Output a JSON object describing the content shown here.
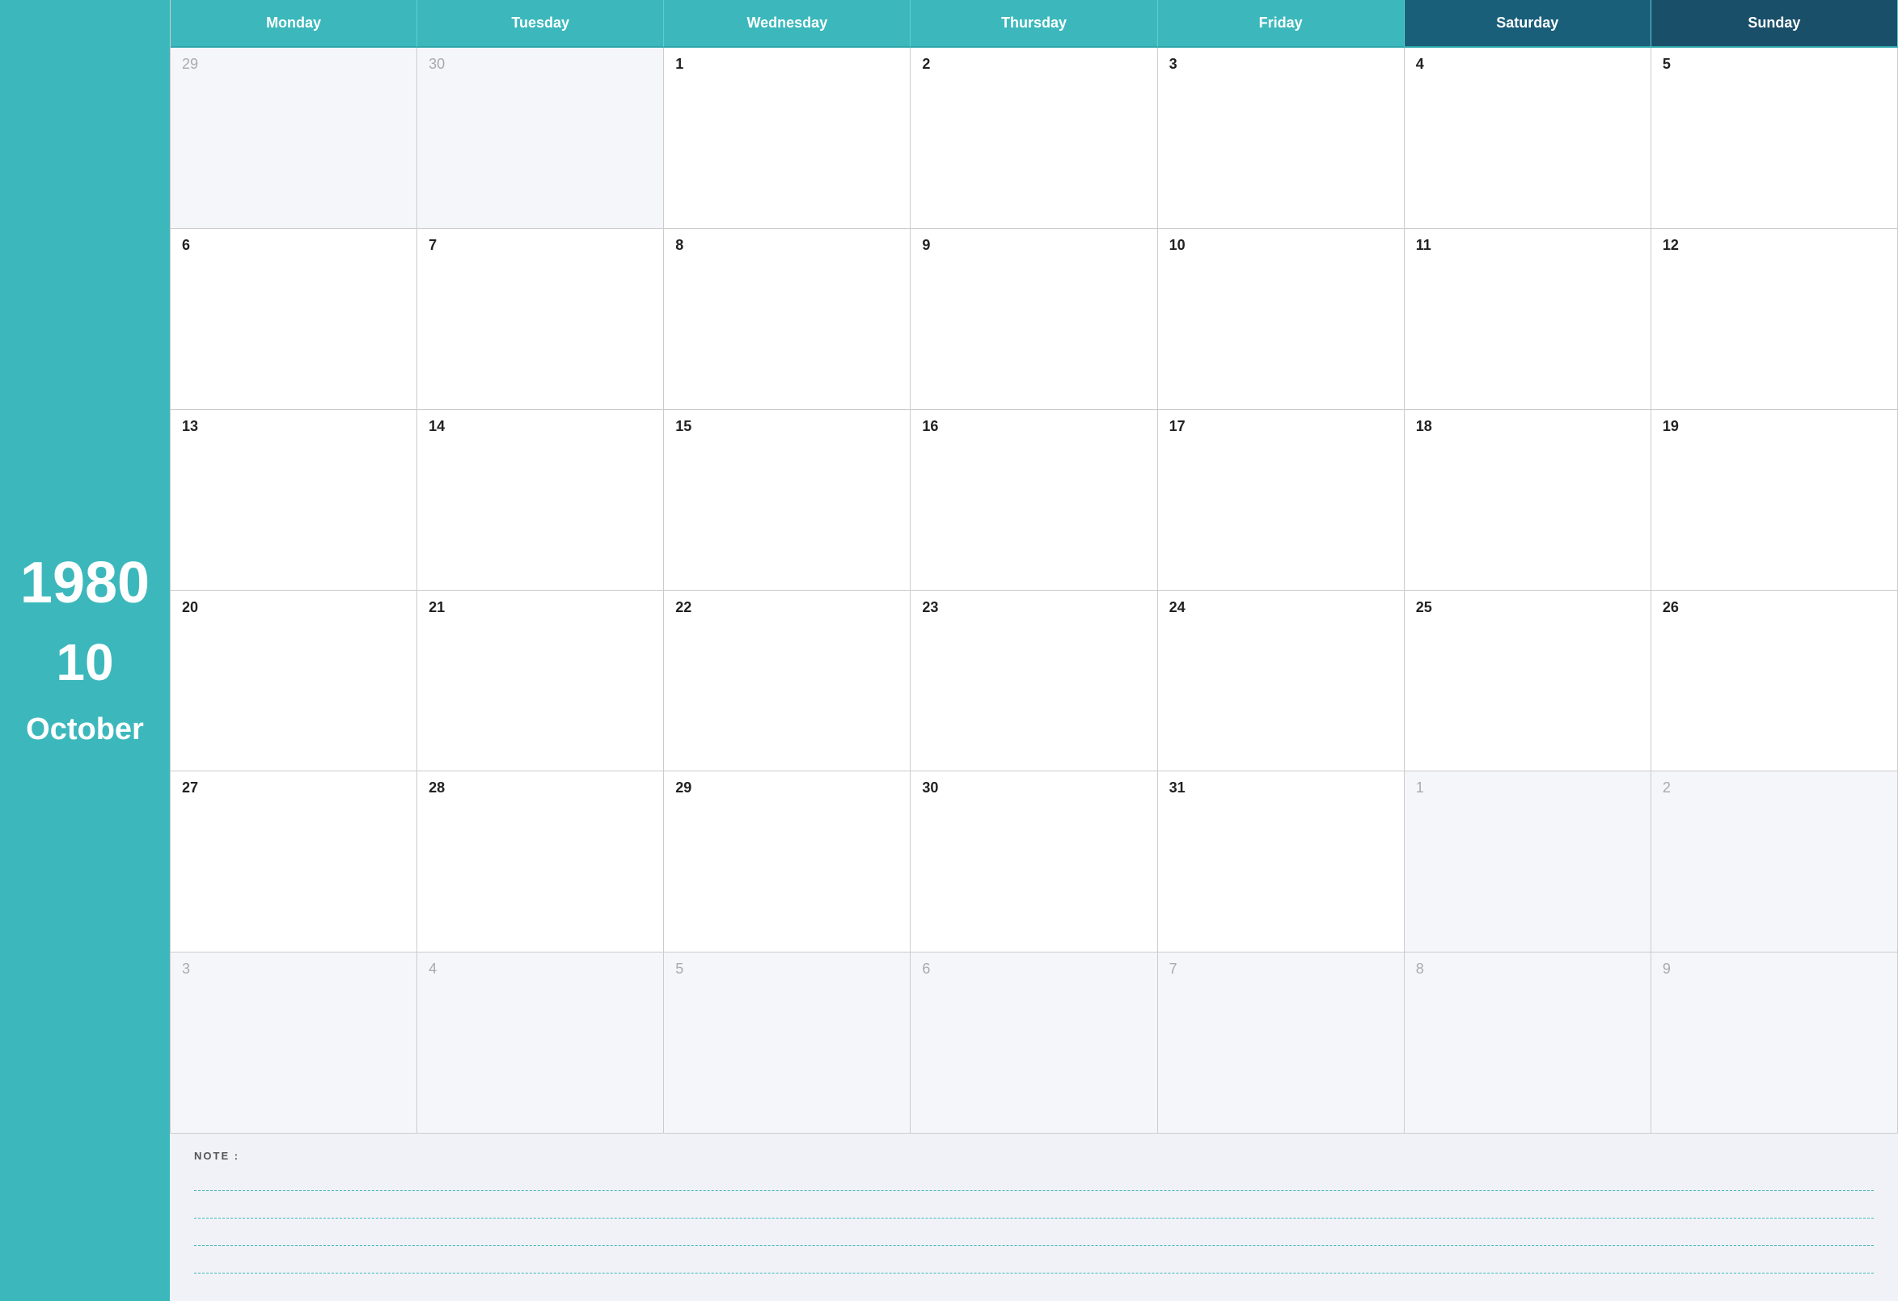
{
  "sidebar": {
    "year": "1980",
    "month_number": "10",
    "month_name": "October"
  },
  "header": {
    "days": [
      {
        "label": "Monday",
        "key": "monday",
        "style": "normal"
      },
      {
        "label": "Tuesday",
        "key": "tuesday",
        "style": "normal"
      },
      {
        "label": "Wednesday",
        "key": "wednesday",
        "style": "normal"
      },
      {
        "label": "Thursday",
        "key": "thursday",
        "style": "normal"
      },
      {
        "label": "Friday",
        "key": "friday",
        "style": "normal"
      },
      {
        "label": "Saturday",
        "key": "saturday",
        "style": "saturday"
      },
      {
        "label": "Sunday",
        "key": "sunday",
        "style": "sunday"
      }
    ]
  },
  "weeks": [
    [
      {
        "num": "29",
        "outside": true
      },
      {
        "num": "30",
        "outside": true
      },
      {
        "num": "1",
        "outside": false
      },
      {
        "num": "2",
        "outside": false
      },
      {
        "num": "3",
        "outside": false
      },
      {
        "num": "4",
        "outside": false
      },
      {
        "num": "5",
        "outside": false
      }
    ],
    [
      {
        "num": "6",
        "outside": false
      },
      {
        "num": "7",
        "outside": false
      },
      {
        "num": "8",
        "outside": false
      },
      {
        "num": "9",
        "outside": false
      },
      {
        "num": "10",
        "outside": false
      },
      {
        "num": "11",
        "outside": false
      },
      {
        "num": "12",
        "outside": false
      }
    ],
    [
      {
        "num": "13",
        "outside": false
      },
      {
        "num": "14",
        "outside": false
      },
      {
        "num": "15",
        "outside": false
      },
      {
        "num": "16",
        "outside": false
      },
      {
        "num": "17",
        "outside": false
      },
      {
        "num": "18",
        "outside": false
      },
      {
        "num": "19",
        "outside": false
      }
    ],
    [
      {
        "num": "20",
        "outside": false
      },
      {
        "num": "21",
        "outside": false
      },
      {
        "num": "22",
        "outside": false
      },
      {
        "num": "23",
        "outside": false
      },
      {
        "num": "24",
        "outside": false
      },
      {
        "num": "25",
        "outside": false
      },
      {
        "num": "26",
        "outside": false
      }
    ],
    [
      {
        "num": "27",
        "outside": false
      },
      {
        "num": "28",
        "outside": false
      },
      {
        "num": "29",
        "outside": false
      },
      {
        "num": "30",
        "outside": false
      },
      {
        "num": "31",
        "outside": false
      },
      {
        "num": "1",
        "outside": true
      },
      {
        "num": "2",
        "outside": true
      }
    ],
    [
      {
        "num": "3",
        "outside": true
      },
      {
        "num": "4",
        "outside": true
      },
      {
        "num": "5",
        "outside": true
      },
      {
        "num": "6",
        "outside": true
      },
      {
        "num": "7",
        "outside": true
      },
      {
        "num": "8",
        "outside": true
      },
      {
        "num": "9",
        "outside": true
      }
    ]
  ],
  "notes": {
    "label": "NOTE :",
    "lines": 4
  },
  "colors": {
    "teal": "#3cb8bc",
    "dark_blue": "#1a5f7a",
    "darker_blue": "#1a4f6a"
  }
}
